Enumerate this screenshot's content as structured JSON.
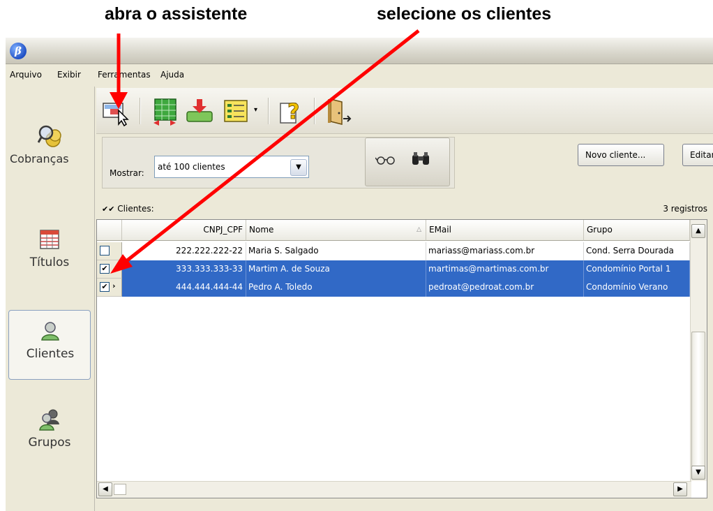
{
  "annotations": {
    "open_wizard": "abra o assistente",
    "select_clients": "selecione os clientes"
  },
  "app": {
    "icon_letter": "β"
  },
  "menu": [
    "Arquivo",
    "Exibir",
    "Ferramentas",
    "Ajuda"
  ],
  "sidebar": {
    "items": [
      {
        "label": "Cobranças",
        "icon": "coins-magnifier-icon"
      },
      {
        "label": "Títulos",
        "icon": "table-icon"
      },
      {
        "label": "Clientes",
        "icon": "client-person-icon",
        "selected": true
      },
      {
        "label": "Grupos",
        "icon": "group-people-icon"
      }
    ]
  },
  "toolbar": {
    "buttons": [
      "wizard-icon",
      "import-export-icon",
      "download-icon",
      "report-icon",
      "help-icon",
      "exit-door-icon"
    ]
  },
  "filter": {
    "label": "Mostrar:",
    "value": "até 100 clientes",
    "icons": [
      "glasses-icon",
      "binoculars-icon"
    ]
  },
  "actions": {
    "new_client": "Novo cliente...",
    "edit": "Editar..."
  },
  "list": {
    "label": "Clientes:",
    "count": "3 registros",
    "columns": [
      "CNPJ_CPF",
      "Nome",
      "EMail",
      "Grupo"
    ],
    "rows": [
      {
        "checked": false,
        "selected": false,
        "cnpj_cpf": "222.222.222-22",
        "nome": "Maria S. Salgado",
        "email": "mariass@mariass.com.br",
        "grupo": "Cond. Serra Dourada"
      },
      {
        "checked": true,
        "selected": true,
        "cnpj_cpf": "333.333.333-33",
        "nome": "Martim A. de Souza",
        "email": "martimas@martimas.com.br",
        "grupo": "Condomínio Portal 1"
      },
      {
        "checked": true,
        "selected": true,
        "current": true,
        "cnpj_cpf": "444.444.444-44",
        "nome": "Pedro A. Toledo",
        "email": "pedroat@pedroat.com.br",
        "grupo": "Condomínio Verano"
      }
    ]
  },
  "colors": {
    "selection": "#3169c6",
    "annotation_arrow": "#ff0000",
    "window_bg": "#ece9d8"
  }
}
